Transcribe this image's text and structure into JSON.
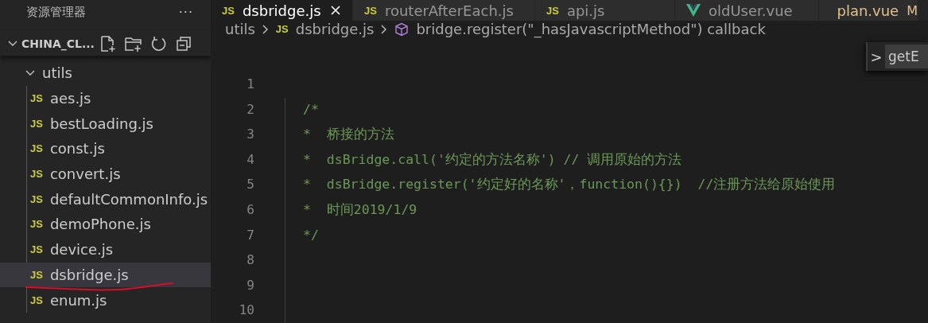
{
  "sidebar": {
    "title": "资源管理器",
    "more": "···",
    "project": {
      "name": "CHINA_CL...",
      "expanded": true
    },
    "folder": {
      "name": "utils",
      "expanded": true,
      "children": [
        {
          "icon": "JS",
          "name": "aes.js",
          "selected": false
        },
        {
          "icon": "JS",
          "name": "bestLoading.js",
          "selected": false
        },
        {
          "icon": "JS",
          "name": "const.js",
          "selected": false
        },
        {
          "icon": "JS",
          "name": "convert.js",
          "selected": false
        },
        {
          "icon": "JS",
          "name": "defaultCommonInfo.js",
          "selected": false
        },
        {
          "icon": "JS",
          "name": "demoPhone.js",
          "selected": false
        },
        {
          "icon": "JS",
          "name": "device.js",
          "selected": false
        },
        {
          "icon": "JS",
          "name": "dsbridge.js",
          "selected": true,
          "annotated": true
        },
        {
          "icon": "JS",
          "name": "enum.js",
          "selected": false
        }
      ]
    }
  },
  "tabs": [
    {
      "icon": "JS",
      "label": "dsbridge.js",
      "kind": "js",
      "selected": true,
      "closable": true
    },
    {
      "icon": "JS",
      "label": "routerAfterEach.js",
      "kind": "js",
      "selected": false
    },
    {
      "icon": "JS",
      "label": "api.js",
      "kind": "js",
      "selected": false
    },
    {
      "label": "oldUser.vue",
      "kind": "vue",
      "selected": false
    },
    {
      "label": "plan.vue",
      "kind": "vue",
      "selected": false,
      "modified": true,
      "badge": "M"
    }
  ],
  "breadcrumb": [
    {
      "label": "utils",
      "kind": "folder"
    },
    {
      "icon": "JS",
      "label": "dsbridge.js",
      "kind": "js"
    },
    {
      "label": "bridge.register(\"_hasJavascriptMethod\") callback",
      "kind": "symbol"
    }
  ],
  "find_widget": {
    "toggle": ">",
    "value": "getE"
  },
  "editor": {
    "lines": [
      {
        "number": "1"
      },
      {
        "number": "2",
        "text": "/*"
      },
      {
        "number": "3",
        "text": "*  桥接的方法"
      },
      {
        "number": "4",
        "text": "*  dsBridge.call('约定的方法名称') // 调用原始的方法"
      },
      {
        "number": "5",
        "text": "*  dsBridge.register('约定好的名称'，function(){})  //注册方法给原始使用"
      },
      {
        "number": "6",
        "text": "*  时间2019/1/9"
      },
      {
        "number": "7",
        "text": "*/"
      },
      {
        "number": "8"
      },
      {
        "number": "9"
      },
      {
        "number": "10"
      }
    ]
  }
}
